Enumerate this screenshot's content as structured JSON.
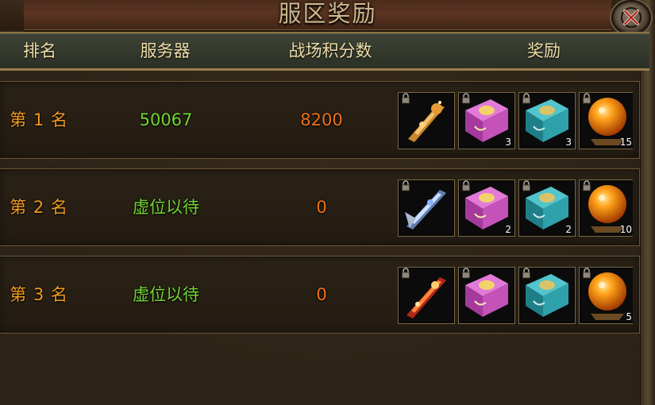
{
  "window": {
    "title": "服区奖励"
  },
  "header": {
    "rank": "排名",
    "server": "服务器",
    "score": "战场积分数",
    "reward": "奖励"
  },
  "rows": [
    {
      "rank": "第 1 名",
      "server": "50067",
      "score": "8200",
      "rewards": [
        {
          "icon": "golden-weapon-icon",
          "qty": ""
        },
        {
          "icon": "pink-gift-box-icon",
          "qty": "3"
        },
        {
          "icon": "teal-gift-box-icon",
          "qty": "3"
        },
        {
          "icon": "orange-orb-icon",
          "qty": "15"
        }
      ]
    },
    {
      "rank": "第 2 名",
      "server": "虚位以待",
      "score": "0",
      "rewards": [
        {
          "icon": "silver-weapon-icon",
          "qty": ""
        },
        {
          "icon": "pink-gift-box-icon",
          "qty": "2"
        },
        {
          "icon": "teal-gift-box-icon",
          "qty": "2"
        },
        {
          "icon": "orange-orb-icon",
          "qty": "10"
        }
      ]
    },
    {
      "rank": "第 3 名",
      "server": "虚位以待",
      "score": "0",
      "rewards": [
        {
          "icon": "fire-weapon-icon",
          "qty": ""
        },
        {
          "icon": "pink-gift-box-icon",
          "qty": ""
        },
        {
          "icon": "teal-gift-box-icon",
          "qty": ""
        },
        {
          "icon": "orange-orb-icon",
          "qty": "5"
        }
      ]
    }
  ],
  "colors": {
    "rank": "#f19a1e",
    "server": "#73d632",
    "score": "#f0731a",
    "header_text": "#f0dda8",
    "title_text": "#cdb88e"
  }
}
